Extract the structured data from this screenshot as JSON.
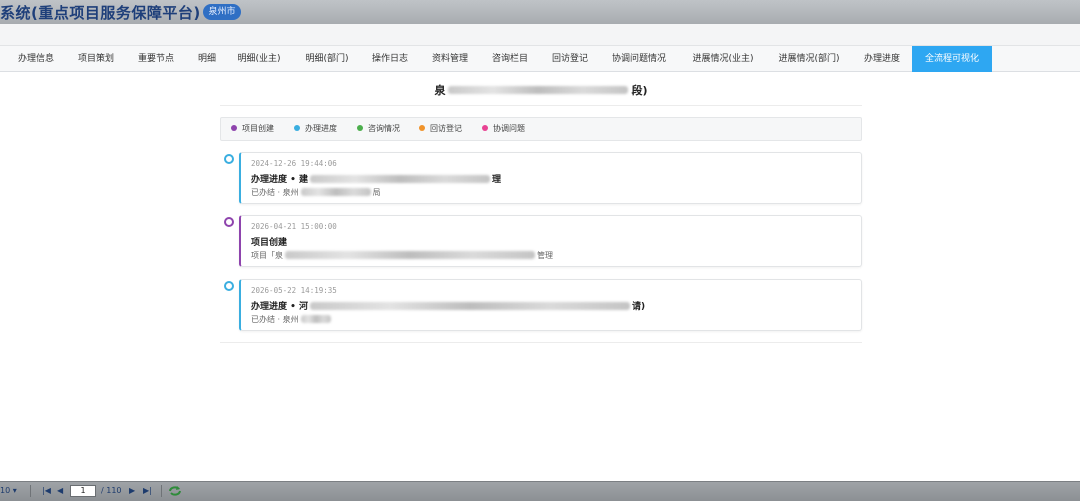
{
  "header": {
    "app_title": "系统(重点项目服务保障平台)",
    "city_badge": "泉州市"
  },
  "tabs": [
    {
      "label": "办理信息"
    },
    {
      "label": "项目策划"
    },
    {
      "label": "重要节点"
    },
    {
      "label": "明细"
    },
    {
      "label": "明细(业主)"
    },
    {
      "label": "明细(部门)"
    },
    {
      "label": "操作日志"
    },
    {
      "label": "资料管理"
    },
    {
      "label": "咨询栏目"
    },
    {
      "label": "回访登记"
    },
    {
      "label": "协调问题情况"
    },
    {
      "label": "进展情况(业主)"
    },
    {
      "label": "进展情况(部门)"
    },
    {
      "label": "办理进度"
    },
    {
      "label": "全流程可视化",
      "active": true
    }
  ],
  "project": {
    "title_start": "泉",
    "title_end": "段)"
  },
  "legend": [
    {
      "label": "项目创建",
      "color": "#8e44ad"
    },
    {
      "label": "办理进度",
      "color": "#3aaee0"
    },
    {
      "label": "咨询情况",
      "color": "#4cae4c"
    },
    {
      "label": "回访登记",
      "color": "#f0932b"
    },
    {
      "label": "协调问题",
      "color": "#e84393"
    }
  ],
  "timeline": [
    {
      "color": "#3aaee0",
      "time": "2024-12-26 19:44:06",
      "head_start": "办理进度 • 建",
      "head_end": "理",
      "sub_start": "已办结 · 泉州",
      "sub_end": "局"
    },
    {
      "color": "#8e44ad",
      "time": "2026-04-21 15:00:00",
      "head_start": "项目创建",
      "head_end": "",
      "sub_start": "项目「泉",
      "sub_end": "管理"
    },
    {
      "color": "#3aaee0",
      "time": "2026-05-22 14:19:35",
      "head_start": "办理进度 • 河",
      "head_end": "请)",
      "sub_start": "已办结 · 泉州",
      "sub_end": ""
    }
  ],
  "footer": {
    "page_size": "10",
    "current_page": "1",
    "total_pages": "/ 110",
    "first_icon": "first-page-icon",
    "prev_icon": "prev-page-icon",
    "next_icon": "next-page-icon",
    "last_icon": "last-page-icon",
    "refresh_icon": "refresh-icon"
  }
}
